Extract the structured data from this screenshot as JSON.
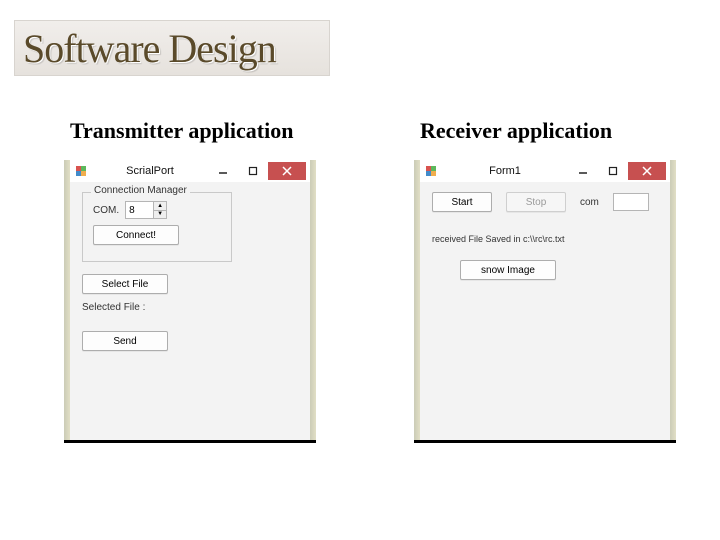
{
  "slide": {
    "title": "Software Design"
  },
  "columns": {
    "left_heading": "Transmitter application",
    "right_heading": "Receiver application"
  },
  "transmitter": {
    "window_title": "ScrialPort",
    "group_title": "Connection Manager",
    "com_label": "COM.",
    "com_value": "8",
    "connect_btn": "Connect!",
    "select_file_btn": "Select File",
    "selected_file_label": "Selected File :",
    "selected_file_value": "",
    "send_btn": "Send"
  },
  "receiver": {
    "window_title": "Form1",
    "start_btn": "Start",
    "stop_btn": "Stop",
    "com_label": "com",
    "com_value": "",
    "status_text": "received File Saved in c:\\\\rc\\rc.txt",
    "show_image_btn": "snow Image"
  }
}
